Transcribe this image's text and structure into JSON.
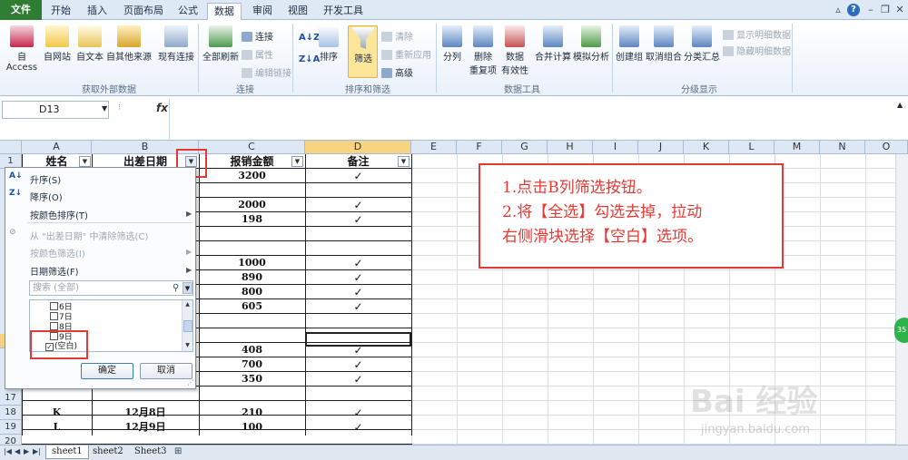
{
  "tabs": {
    "file": "文件",
    "home": "开始",
    "insert": "插入",
    "layout": "页面布局",
    "formulas": "公式",
    "data": "数据",
    "review": "审阅",
    "view": "视图",
    "developer": "开发工具"
  },
  "ribbon": {
    "ext": {
      "access": "自 Access",
      "web": "自网站",
      "text": "自文本",
      "other": "自其他来源",
      "existing": "现有连接",
      "group": "获取外部数据"
    },
    "conn": {
      "refresh": "全部刷新",
      "connections": "连接",
      "properties": "属性",
      "edit_links": "编辑链接",
      "group": "连接"
    },
    "sort": {
      "sort_asc": "A↓Z",
      "sort_desc": "Z↓A",
      "sort": "排序",
      "filter": "筛选",
      "clear": "清除",
      "reapply": "重新应用",
      "advanced": "高级",
      "group": "排序和筛选"
    },
    "tools": {
      "split": "分列",
      "remove_dup_1": "删除",
      "remove_dup_2": "重复项",
      "validation_1": "数据",
      "validation_2": "有效性",
      "consolidate": "合并计算",
      "whatif": "模拟分析",
      "group": "数据工具"
    },
    "outline": {
      "group_btn": "创建组",
      "ungroup": "取消组合",
      "subtotal": "分类汇总",
      "show_detail": "显示明细数据",
      "hide_detail": "隐藏明细数据",
      "group": "分级显示"
    }
  },
  "namebox": "D13",
  "fx": "fx",
  "columns": [
    "A",
    "B",
    "C",
    "D",
    "E",
    "F",
    "G",
    "H",
    "I",
    "J",
    "K",
    "L",
    "M",
    "N",
    "O"
  ],
  "rows": [
    "1",
    "17",
    "18",
    "19",
    "20"
  ],
  "table": {
    "headers": [
      "姓名",
      "出差日期",
      "报销金额",
      "备注"
    ],
    "amounts": [
      "3200",
      "",
      "2000",
      "198",
      "",
      "",
      "1000",
      "890",
      "800",
      "605",
      "",
      "",
      "408",
      "700",
      "350"
    ],
    "bottom_rows": [
      {
        "name": "K",
        "date": "12月8日",
        "amount": "210",
        "note": "✓"
      },
      {
        "name": "L",
        "date": "12月9日",
        "amount": "100",
        "note": "✓"
      }
    ],
    "check": "✓"
  },
  "filter_menu": {
    "sort_asc": "升序(S)",
    "sort_desc": "降序(O)",
    "sort_color": "按颜色排序(T)",
    "clear": "从 \"出差日期\" 中清除筛选(C)",
    "filter_color": "按颜色筛选(I)",
    "date_filter": "日期筛选(F)",
    "search_placeholder": "搜索 (全部)",
    "list_items": [
      "6日",
      "7日",
      "8日",
      "9日"
    ],
    "blank_item": "(空白)",
    "ok": "确定",
    "cancel": "取消"
  },
  "annotation": {
    "line1": "1.点击B列筛选按钮。",
    "line2": "2.将【全选】勾选去掉，拉动",
    "line3": "右侧滑块选择【空白】选项。"
  },
  "sheets": [
    "sheet1",
    "sheet2",
    "Sheet3"
  ],
  "watermark": "Bai 经验",
  "watermark_url": "jingyan.baidu.com",
  "side_badge": "35",
  "colors": {
    "accent_red": "#e53935",
    "file_tab": "#2e7d32",
    "selected_header": "#f7d382"
  }
}
